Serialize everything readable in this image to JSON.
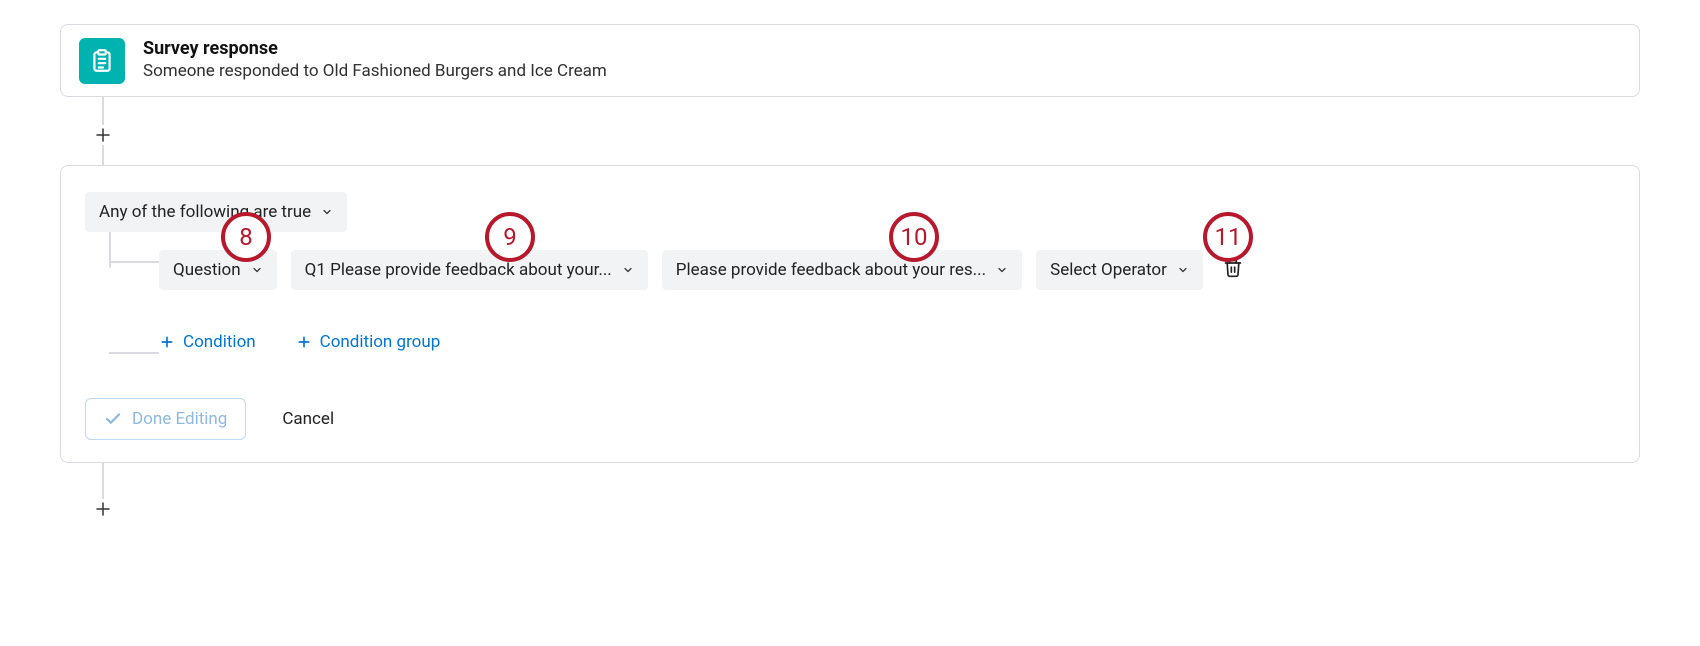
{
  "trigger": {
    "title": "Survey response",
    "subtitle": "Someone responded to Old Fashioned Burgers and Ice Cream"
  },
  "match_mode": {
    "label": "Any of the following are true"
  },
  "condition": {
    "field_type": "Question",
    "question": "Q1 Please provide feedback about your...",
    "sub_question": "Please provide feedback about your res...",
    "operator": "Select Operator"
  },
  "actions": {
    "add_condition": "Condition",
    "add_condition_group": "Condition group"
  },
  "footer": {
    "done": "Done Editing",
    "cancel": "Cancel"
  },
  "callouts": {
    "c8": "8",
    "c9": "9",
    "c10": "10",
    "c11": "11"
  }
}
